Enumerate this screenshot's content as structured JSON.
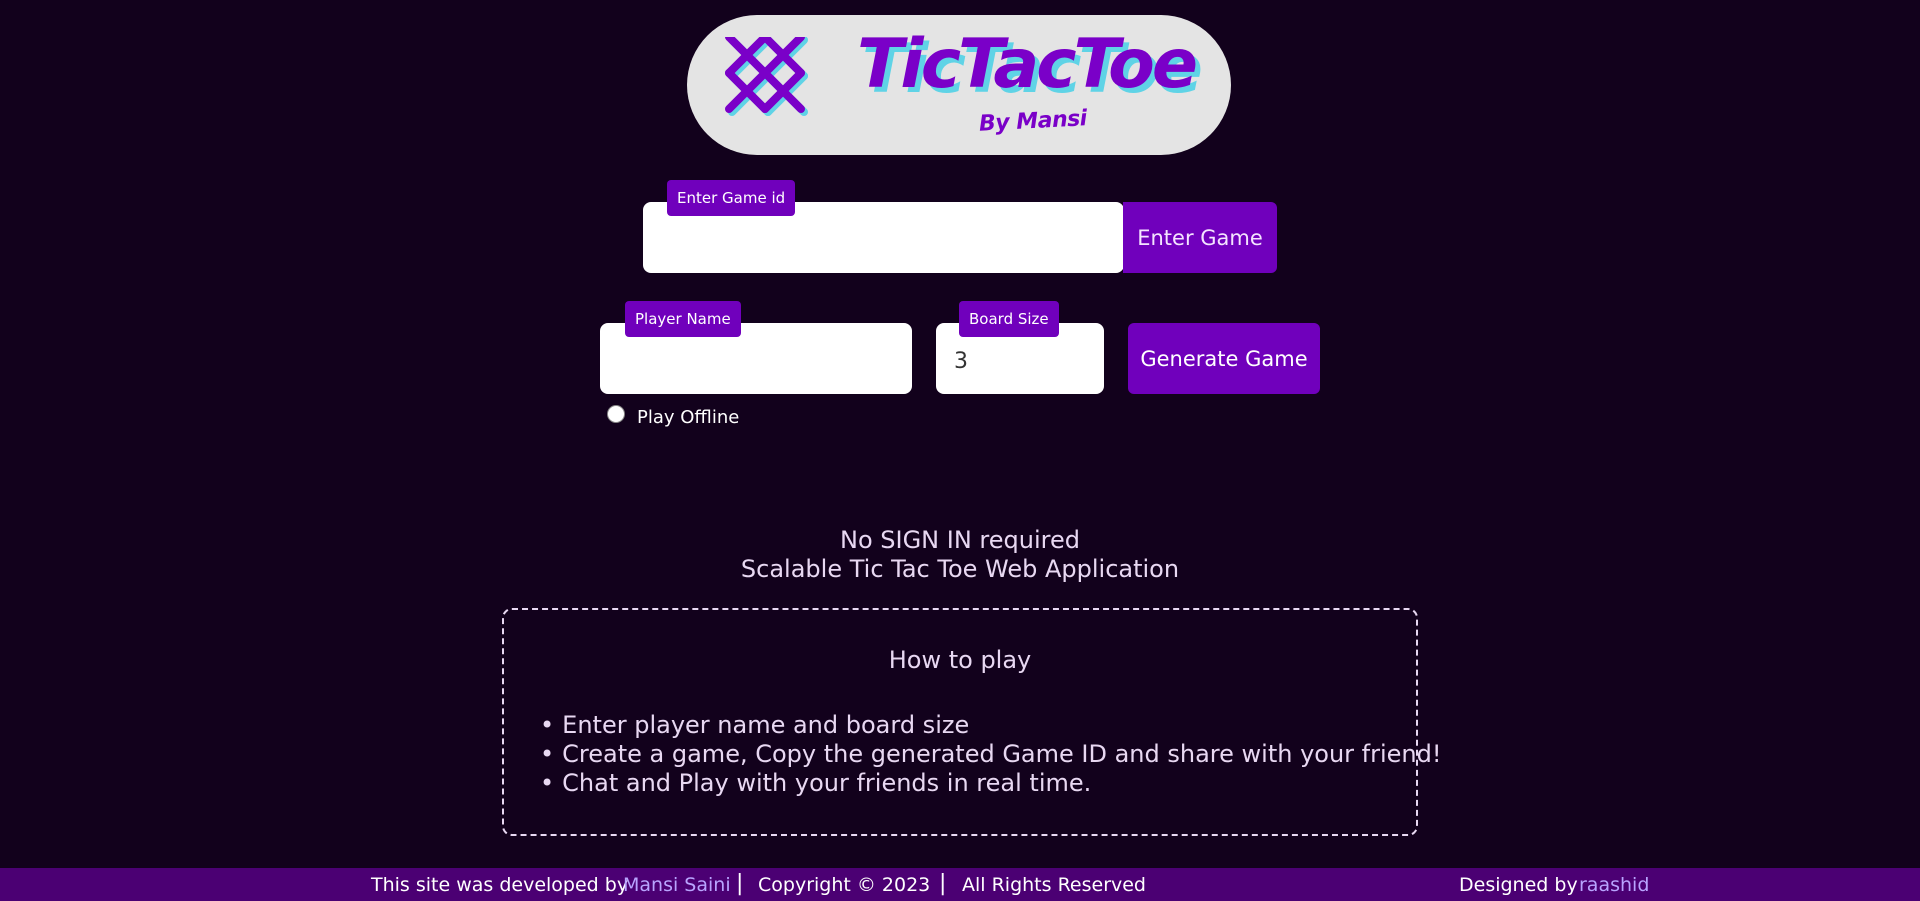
{
  "logo": {
    "icon": "hashtag-x-icon",
    "title": "TicTacToe",
    "subtitle": "By Mansi",
    "colors": {
      "primary": "#7a00c8",
      "shadow": "#5fd3e6",
      "background": "#e4e4e4"
    }
  },
  "join": {
    "game_id_label": "Enter Game id",
    "game_id_value": "",
    "enter_button": "Enter Game"
  },
  "create": {
    "player_name_label": "Player Name",
    "player_name_value": "",
    "board_size_label": "Board Size",
    "board_size_value": "3",
    "generate_button": "Generate Game",
    "play_offline_label": "Play Offline",
    "play_offline_checked": false
  },
  "tagline": {
    "line1": "No SIGN IN required",
    "line2": "Scalable Tic Tac Toe Web Application"
  },
  "how_to_play": {
    "title": "How to play",
    "steps": [
      "Enter player name and board size",
      "Create a game, Copy the generated Game ID and share with your friend!",
      "Chat and Play with your friends in real time."
    ]
  },
  "footer": {
    "developed_prefix": "This site was developed by",
    "developer_name": "Mansi Saini",
    "separator": "|",
    "copyright": "Copyright © 2023",
    "rights": "All Rights Reserved",
    "designed_prefix": "Designed by",
    "designer_name": "raashid"
  },
  "colors": {
    "background": "#12011c",
    "accent": "#7000bc",
    "footer": "#4b0073",
    "link": "#b9a4ff"
  }
}
